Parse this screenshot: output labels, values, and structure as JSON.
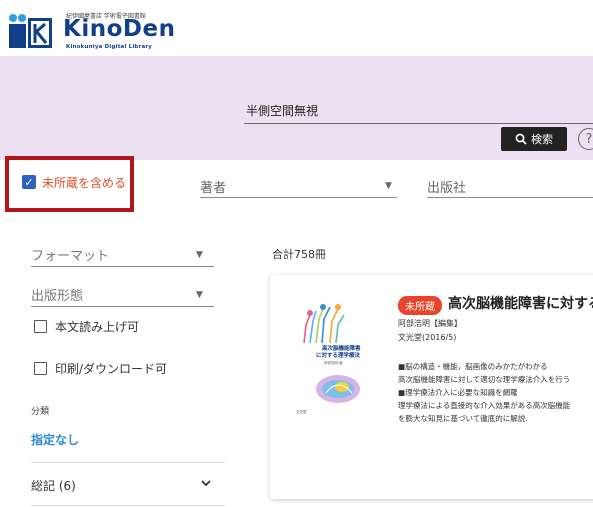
{
  "header": {
    "logo_small_text": "紀伊國屋書店 学術電子図書館",
    "logo_main": "KinoDen",
    "logo_sub": "Kinokuniya Digital Library"
  },
  "search": {
    "title_value": "半側空間無視",
    "search_button_label": "検索",
    "help_label": "?"
  },
  "filters": {
    "include_unowned_label": "未所蔵を含める",
    "include_unowned_checked": true,
    "author_label": "著者",
    "publisher_label": "出版社"
  },
  "sidebar": {
    "format_label": "フォーマット",
    "pub_type_label": "出版形態",
    "read_aloud_label": "本文読み上げ可",
    "print_download_label": "印刷/ダウンロード可",
    "category_heading": "分類",
    "category_value": "指定なし",
    "category_item": "総記 (6)"
  },
  "results": {
    "total_label": "合計758冊",
    "card": {
      "badge": "未所蔵",
      "title": "高次脳機能障害に対する",
      "author": "阿部浩明【編集】",
      "publisher": "文光堂(2016/5)",
      "description": [
        "■脳の構造・機能，脳画像のみかたがわかる",
        "高次脳機能障害に対して適切な理学療法介入を行う",
        "■理学療法介入に必要な知識を網羅",
        "理学療法による直接的な介入効果がある高次脳機能",
        "を膨大な知見に基づいて徹底的に解説."
      ]
    }
  },
  "colors": {
    "search_band": "#ece0f3",
    "highlight_border": "#b3141d",
    "checkbox_blue": "#2e62bf",
    "unowned_text": "#e64b2a",
    "badge_red": "#e9452b",
    "link_blue": "#2a89d8",
    "brand_navy": "#123f8a"
  },
  "icons": {
    "search_icon": "magnifier",
    "help_icon": "question-circle",
    "chevron_icon": "chevron-down"
  }
}
